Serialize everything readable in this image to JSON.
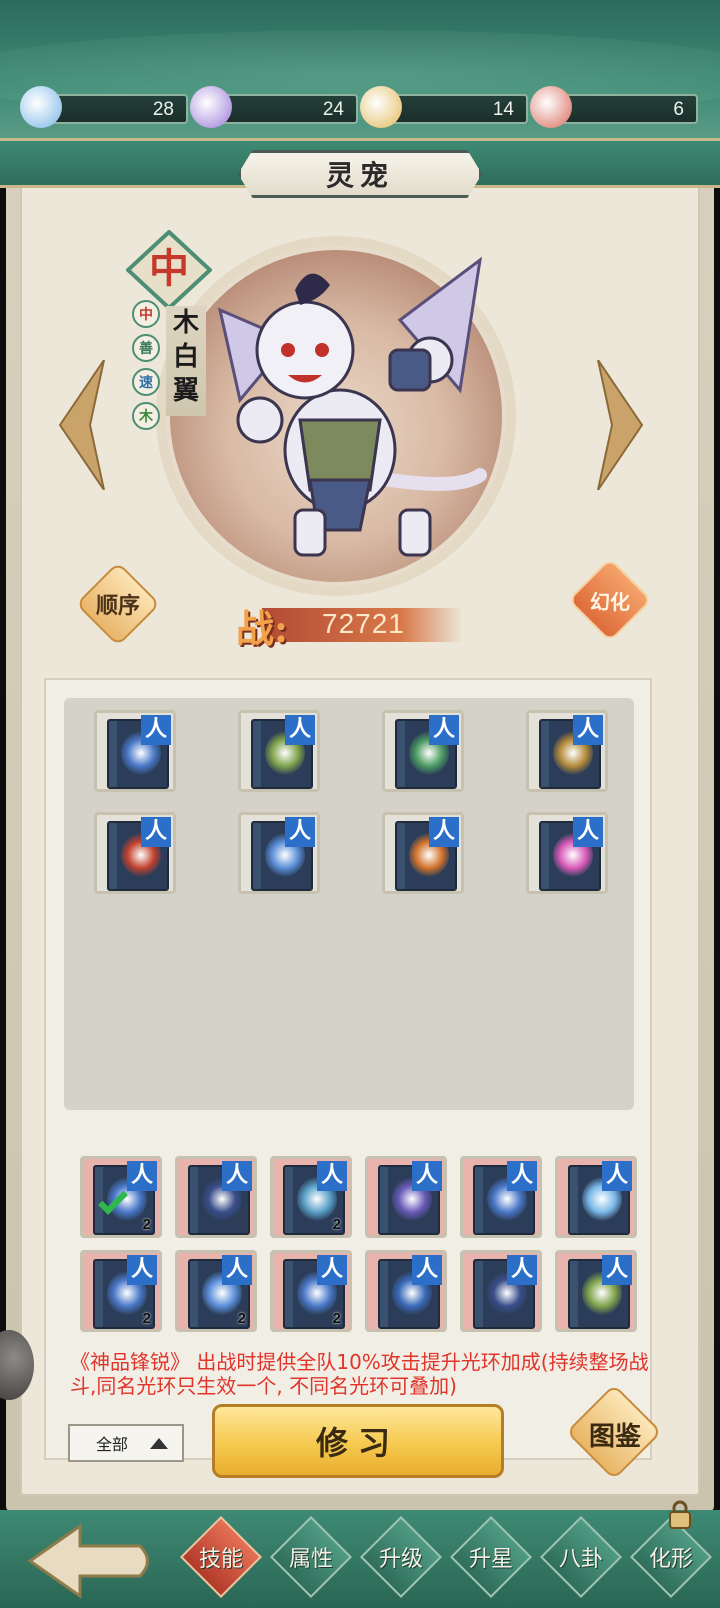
{
  "resources": [
    {
      "icon": "blue-spirit-icon",
      "value": "28",
      "color": "#7ab6e8"
    },
    {
      "icon": "purple-spirit-icon",
      "value": "24",
      "color": "#9a7ad8"
    },
    {
      "icon": "yellow-spirit-icon",
      "value": "14",
      "color": "#e2b95a"
    },
    {
      "icon": "red-spirit-icon",
      "value": "6",
      "color": "#d86a5a"
    }
  ],
  "title": "灵宠",
  "pet": {
    "grade": "中",
    "tags": [
      {
        "text": "中",
        "color": "#c4392c"
      },
      {
        "text": "善",
        "color": "#3a7a5e"
      },
      {
        "text": "速",
        "color": "#2f6fa8"
      },
      {
        "text": "木",
        "color": "#3a8a3e"
      }
    ],
    "name": [
      "木",
      "白",
      "翼"
    ],
    "power_label": "战:",
    "power_value": "72721"
  },
  "buttons": {
    "order": "顺序",
    "transform": "幻化",
    "learn": "修习",
    "codex": "图鉴",
    "filter": "全部"
  },
  "equipped_skills": [
    {
      "tint": "#4a78c8",
      "badge": "人"
    },
    {
      "tint": "#7fa34b",
      "badge": "人"
    },
    {
      "tint": "#4c9a62",
      "badge": "人"
    },
    {
      "tint": "#b38a3a",
      "badge": "人"
    },
    {
      "tint": "#c2412e",
      "badge": "人"
    },
    {
      "tint": "#5a8ed8",
      "badge": "人"
    },
    {
      "tint": "#d2722c",
      "badge": "人"
    },
    {
      "tint": "#d85ab8",
      "badge": "人"
    }
  ],
  "inventory_skills": [
    {
      "tint": "#4a78c8",
      "badge": "人",
      "count": "2",
      "checked": true
    },
    {
      "tint": "#3a4e8a",
      "badge": "人",
      "count": "",
      "checked": false
    },
    {
      "tint": "#5aa0c8",
      "badge": "人",
      "count": "2",
      "checked": false
    },
    {
      "tint": "#6a5ab8",
      "badge": "人",
      "count": "",
      "checked": false
    },
    {
      "tint": "#4a78c8",
      "badge": "人",
      "count": "",
      "checked": false
    },
    {
      "tint": "#7ab8e8",
      "badge": "人",
      "count": "",
      "checked": false
    },
    {
      "tint": "#4a78c8",
      "badge": "人",
      "count": "2",
      "checked": false
    },
    {
      "tint": "#5a8ed8",
      "badge": "人",
      "count": "2",
      "checked": false
    },
    {
      "tint": "#4a78c8",
      "badge": "人",
      "count": "2",
      "checked": false
    },
    {
      "tint": "#3a6ab8",
      "badge": "人",
      "count": "",
      "checked": false
    },
    {
      "tint": "#3a4e8a",
      "badge": "人",
      "count": "",
      "checked": false
    },
    {
      "tint": "#7fa34b",
      "badge": "人",
      "count": "",
      "checked": false
    }
  ],
  "description": "《神品锋锐》  出战时提供全队10%攻击提升光环加成(持续整场战斗,同名光环只生效一个, 不同名光环可叠加)",
  "nav_tabs": [
    {
      "label": "技能",
      "active": true
    },
    {
      "label": "属性",
      "active": false
    },
    {
      "label": "升级",
      "active": false
    },
    {
      "label": "升星",
      "active": false
    },
    {
      "label": "八卦",
      "active": false
    },
    {
      "label": "化形",
      "active": false
    }
  ]
}
